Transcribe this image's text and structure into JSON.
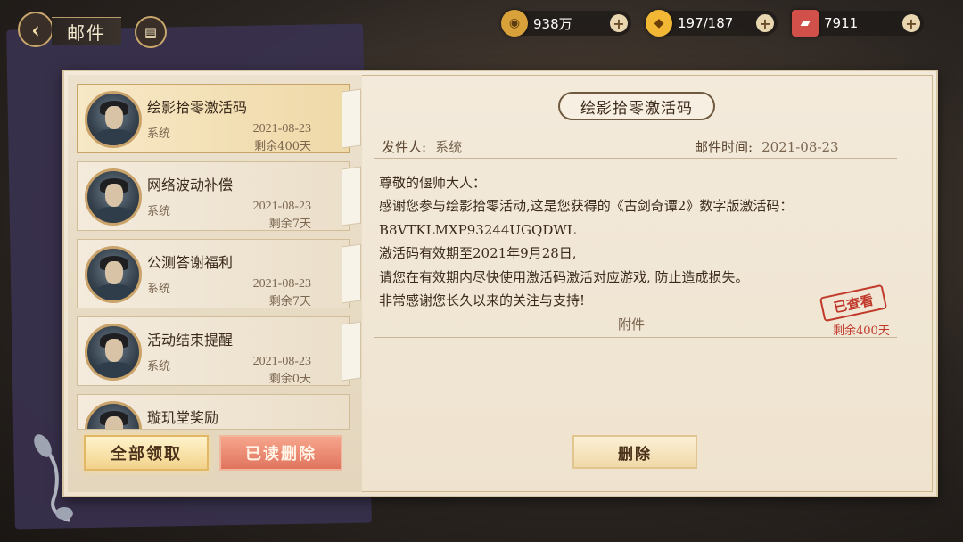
{
  "header": {
    "title": "邮件",
    "back_icon": "back-arrow-icon",
    "chat_icon": "chat-icon"
  },
  "resources": [
    {
      "name": "copper-coin",
      "value": "938万",
      "icon": "coin-icon",
      "color": "#d9a13a"
    },
    {
      "name": "gold-ingots",
      "value": "197/187",
      "icon": "ingot-icon",
      "color": "#f2b734"
    },
    {
      "name": "tickets",
      "value": "7911",
      "icon": "ticket-icon",
      "color": "#d2504a"
    }
  ],
  "mail_list": [
    {
      "title": "绘影拾零激活码",
      "sender": "系统",
      "date": "2021-08-23",
      "remaining": "剩余400天",
      "selected": true
    },
    {
      "title": "网络波动补偿",
      "sender": "系统",
      "date": "2021-08-23",
      "remaining": "剩余7天"
    },
    {
      "title": "公测答谢福利",
      "sender": "系统",
      "date": "2021-08-23",
      "remaining": "剩余7天"
    },
    {
      "title": "活动结束提醒",
      "sender": "系统",
      "date": "2021-08-23",
      "remaining": "剩余0天"
    },
    {
      "title": "璇玑堂奖励",
      "sender": "",
      "date": "",
      "remaining": ""
    }
  ],
  "actions": {
    "claim_all": "全部领取",
    "delete_read": "已读删除",
    "delete": "删除"
  },
  "detail": {
    "title": "绘影拾零激活码",
    "sender_label": "发件人:",
    "sender": "系统",
    "time_label": "邮件时间:",
    "time": "2021-08-23",
    "body": [
      "尊敬的偃师大人：",
      "感谢您参与绘影拾零活动,这是您获得的《古剑奇谭2》数字版激活码：",
      "B8VTKLMXP93244UGQDWL",
      "激活码有效期至2021年9月28日,",
      "请您在有效期内尽快使用激活码激活对应游戏, 防止造成损失。",
      "非常感谢您长久以来的关注与支持!"
    ],
    "attachment_label": "附件",
    "stamp": "已查看",
    "stamp_remaining": "剩余400天"
  }
}
